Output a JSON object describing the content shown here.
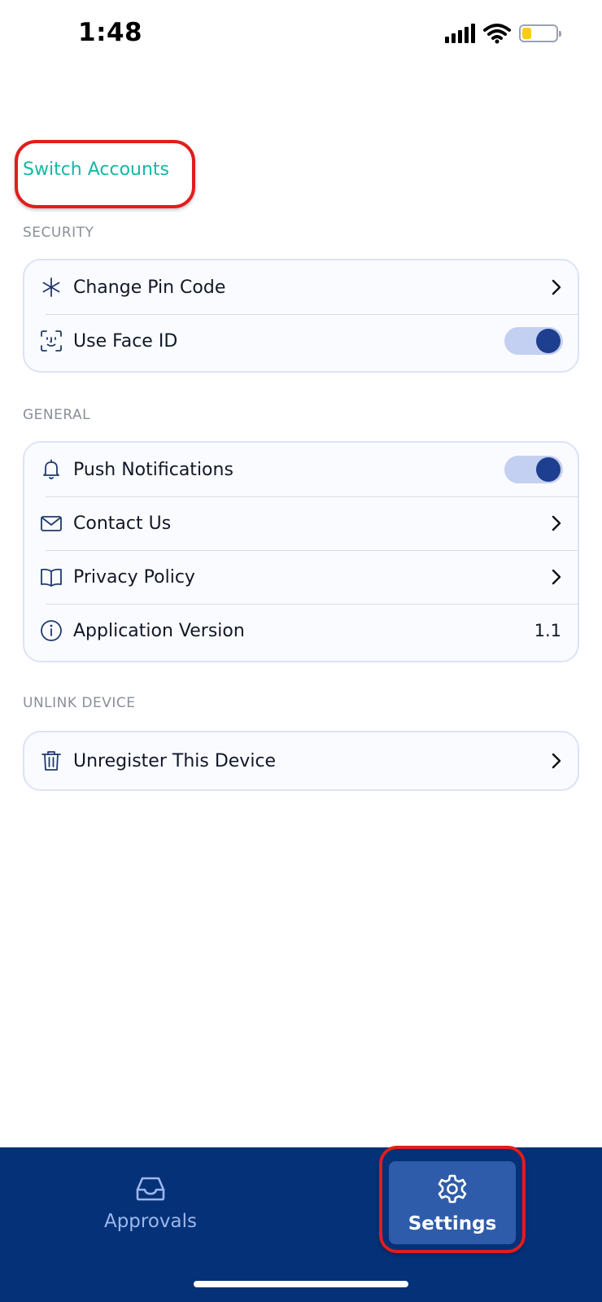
{
  "status_bar": {
    "time": "1:48",
    "battery_level": 0.28
  },
  "switch_accounts": {
    "label": "Switch Accounts"
  },
  "sections": {
    "security": {
      "title": "SECURITY",
      "rows": [
        {
          "label": "Change Pin Code",
          "icon": "asterisk-icon",
          "accessory": "chevron"
        },
        {
          "label": "Use Face ID",
          "icon": "face-id-icon",
          "accessory": "toggle",
          "on": true
        }
      ]
    },
    "general": {
      "title": "GENERAL",
      "rows": [
        {
          "label": "Push Notifications",
          "icon": "bell-icon",
          "accessory": "toggle",
          "on": true
        },
        {
          "label": "Contact Us",
          "icon": "mail-icon",
          "accessory": "chevron"
        },
        {
          "label": "Privacy Policy",
          "icon": "book-icon",
          "accessory": "chevron"
        },
        {
          "label": "Application Version",
          "icon": "info-icon",
          "accessory": "value",
          "value": "1.1"
        }
      ]
    },
    "unlink": {
      "title": "UNLINK DEVICE",
      "rows": [
        {
          "label": "Unregister This Device",
          "icon": "trash-icon",
          "accessory": "chevron"
        }
      ]
    }
  },
  "bottom_nav": {
    "approvals_label": "Approvals",
    "settings_label": "Settings",
    "active": "settings"
  },
  "colors": {
    "accent_teal": "#14b8a6",
    "nav_background": "#043177",
    "toggle_on_knob": "#1e3f8f",
    "annotation_red": "#e11d1d"
  }
}
